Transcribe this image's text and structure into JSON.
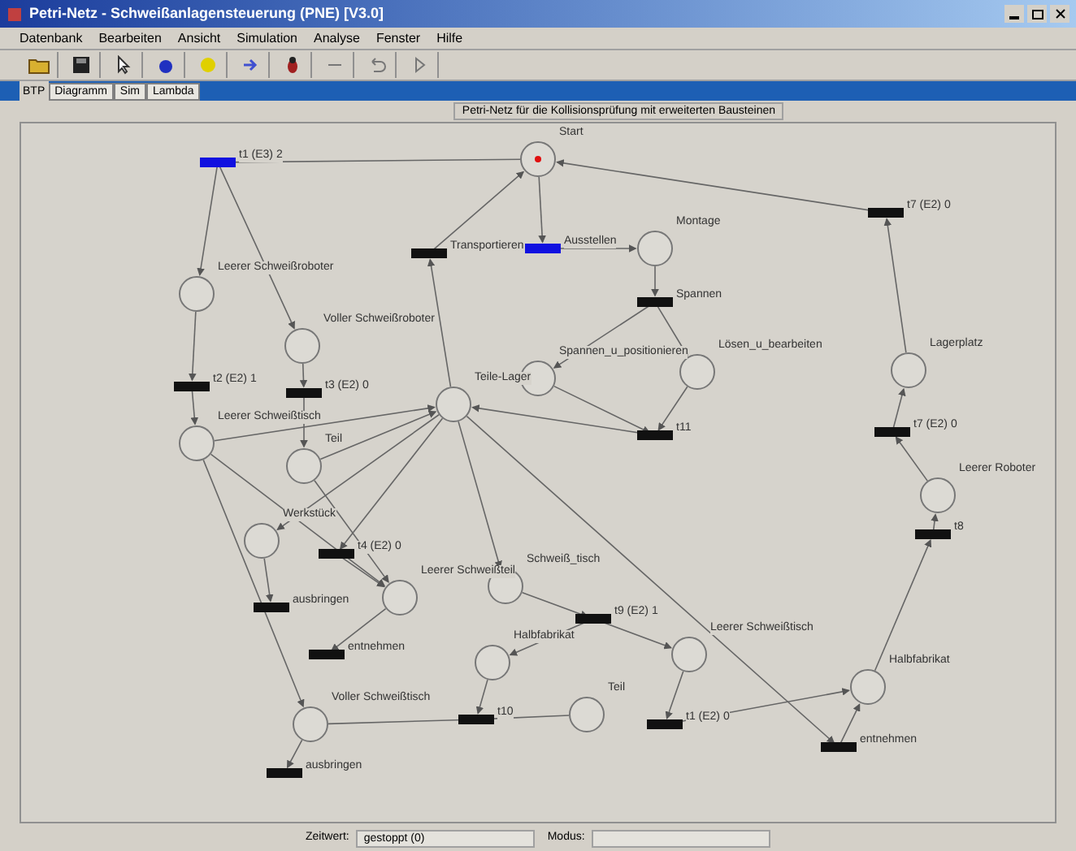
{
  "window": {
    "title": "Petri-Netz - Schweißanlagensteuerung (PNE) [V3.0]"
  },
  "menu": [
    "Datenbank",
    "Bearbeiten",
    "Ansicht",
    "Simulation",
    "Analyse",
    "Fenster",
    "Hilfe"
  ],
  "tabs": [
    {
      "label": "BTP",
      "selected": true
    },
    {
      "label": "Diagramm",
      "selected": false
    },
    {
      "label": "Sim",
      "selected": false
    },
    {
      "label": "Lambda",
      "selected": false
    }
  ],
  "canvas_title": "Petri-Netz für die Kollisionsprüfung mit erweiterten Bausteinen",
  "nodes": [
    {
      "kind": "place",
      "label": "Start",
      "marked": true
    },
    {
      "kind": "place",
      "label": "Leerer Schweißroboter",
      "marked": false
    },
    {
      "kind": "place",
      "label": "Voller Schweißroboter",
      "marked": false
    },
    {
      "kind": "place",
      "label": "Leerer Schweißtisch",
      "marked": false
    },
    {
      "kind": "place",
      "label": "Teil",
      "marked": false
    },
    {
      "kind": "place",
      "label": "Teile-Lager",
      "marked": false
    },
    {
      "kind": "place",
      "label": "Montage",
      "marked": false
    },
    {
      "kind": "place",
      "label": "Spannen_u_positionieren",
      "marked": false
    },
    {
      "kind": "place",
      "label": "Lösen_u_bearbeiten",
      "marked": false
    },
    {
      "kind": "place",
      "label": "Lagerplatz",
      "marked": false
    },
    {
      "kind": "place",
      "label": "Leerer Roboter",
      "marked": false
    },
    {
      "kind": "place",
      "label": "Werkstück",
      "marked": false
    },
    {
      "kind": "place",
      "label": "Leerer Schweißteil",
      "marked": false
    },
    {
      "kind": "place",
      "label": "Schweiß_tisch",
      "marked": false
    },
    {
      "kind": "place",
      "label": "Halbfabrikat",
      "marked": false
    },
    {
      "kind": "place",
      "label": "Teil",
      "marked": false
    },
    {
      "kind": "place",
      "label": "Leerer Schweißtisch",
      "marked": false
    },
    {
      "kind": "place",
      "label": "Halbfabrikat",
      "marked": false
    },
    {
      "kind": "place",
      "label": "Voller Schweißtisch",
      "marked": false
    },
    {
      "kind": "transition",
      "label": "t1 (E3) 2",
      "enabled": true
    },
    {
      "kind": "transition",
      "label": "Transportieren",
      "enabled": false
    },
    {
      "kind": "transition",
      "label": "Ausstellen",
      "enabled": true
    },
    {
      "kind": "transition",
      "label": "t7 (E2) 0",
      "enabled": false
    },
    {
      "kind": "transition",
      "label": "Spannen",
      "enabled": false
    },
    {
      "kind": "transition",
      "label": "t2 (E2) 1",
      "enabled": false
    },
    {
      "kind": "transition",
      "label": "t3 (E2) 0",
      "enabled": false
    },
    {
      "kind": "transition",
      "label": "t11",
      "enabled": false
    },
    {
      "kind": "transition",
      "label": "t7 (E2) 0",
      "enabled": false
    },
    {
      "kind": "transition",
      "label": "t8",
      "enabled": false
    },
    {
      "kind": "transition",
      "label": "ausbringen",
      "enabled": false
    },
    {
      "kind": "transition",
      "label": "t4 (E2) 0",
      "enabled": false
    },
    {
      "kind": "transition",
      "label": "entnehmen",
      "enabled": false
    },
    {
      "kind": "transition",
      "label": "t9 (E2) 1",
      "enabled": false
    },
    {
      "kind": "transition",
      "label": "t10",
      "enabled": false
    },
    {
      "kind": "transition",
      "label": "t1 (E2) 0",
      "enabled": false
    },
    {
      "kind": "transition",
      "label": "entnehmen",
      "enabled": false
    },
    {
      "kind": "transition",
      "label": "ausbringen",
      "enabled": false
    }
  ],
  "status_bar": [
    {
      "label": "Zeitwert:",
      "value": "gestoppt (0)"
    },
    {
      "label": "Modus:"
    }
  ]
}
